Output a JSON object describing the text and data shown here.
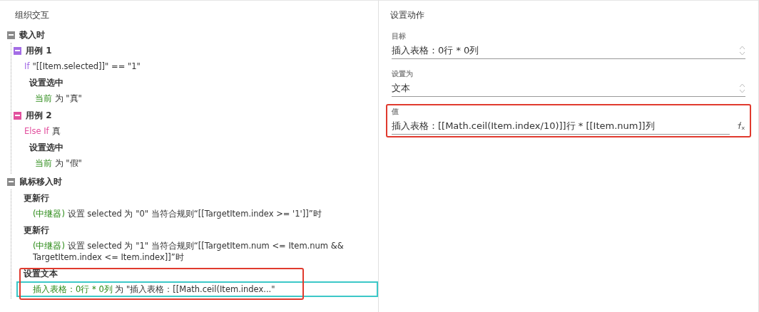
{
  "left_panel": {
    "title": "组织交互",
    "events": [
      {
        "label": "载入时",
        "expanded": true,
        "children": [
          {
            "kind": "case",
            "label": "用例 1",
            "expanded": true,
            "color": "#a46de6",
            "condition": {
              "keyword": "If",
              "text": "\"[[Item.selected]]\" == \"1\""
            },
            "actions": [
              {
                "title": "设置选中",
                "highlighted": false,
                "lines": [
                  {
                    "target": "当前",
                    "text": "为 \"真\"",
                    "selected": false
                  }
                ]
              }
            ]
          },
          {
            "kind": "case",
            "label": "用例 2",
            "expanded": true,
            "color": "#e2509e",
            "condition": {
              "keyword": "Else If",
              "text": "真"
            },
            "actions": [
              {
                "title": "设置选中",
                "highlighted": false,
                "lines": [
                  {
                    "target": "当前",
                    "text": "为 \"假\"",
                    "selected": false
                  }
                ]
              }
            ]
          }
        ]
      },
      {
        "label": "鼠标移入时",
        "expanded": true,
        "children": [
          {
            "kind": "action",
            "title": "更新行",
            "highlighted": false,
            "lines": [
              {
                "target": "(中继器)",
                "text": "设置 selected 为 \"0\" 当符合规则“[[TargetItem.index >= '1']]”时",
                "selected": false
              }
            ]
          },
          {
            "kind": "action",
            "title": "更新行",
            "highlighted": false,
            "lines": [
              {
                "target": "(中继器)",
                "text": "设置 selected 为 \"1\" 当符合规则“[[TargetItem.num <= Item.num && TargetItem.index <= Item.index]]”时",
                "selected": false
              }
            ]
          },
          {
            "kind": "action",
            "title": "设置文本",
            "highlighted": true,
            "lines": [
              {
                "target": "插入表格：0行 * 0列",
                "text": "为 \"插入表格：[[Math.ceil(Item.index...\"",
                "selected": true
              }
            ]
          }
        ]
      }
    ]
  },
  "right_panel": {
    "title": "设置动作",
    "fields": [
      {
        "kind": "select",
        "label": "目标",
        "value": "插入表格：0行 * 0列",
        "highlighted": false
      },
      {
        "kind": "select",
        "label": "设置为",
        "value": "文本",
        "highlighted": false
      },
      {
        "kind": "formula",
        "label": "值",
        "value": "插入表格：[[Math.ceil(Item.index/10)]]行 * [[Item.num]]列",
        "highlighted": true
      }
    ]
  }
}
